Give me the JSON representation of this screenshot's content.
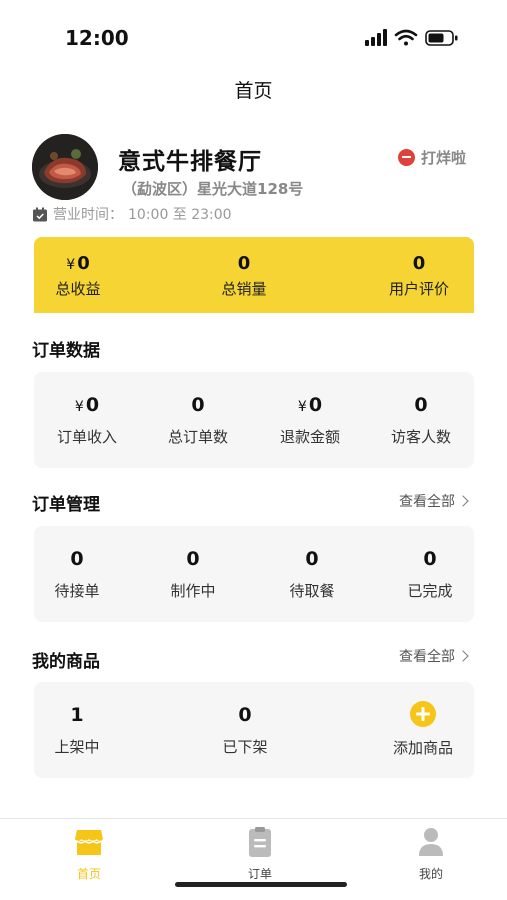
{
  "status_bar": {
    "time": "12:00"
  },
  "nav": {
    "title": "首页"
  },
  "store": {
    "name": "意式牛排餐厅",
    "address": "（勐波区）星光大道128号",
    "close_label": "打烊啦",
    "hours_label": "营业时间：",
    "hours_value": "10:00 至 23:00"
  },
  "summary": {
    "currency": "¥",
    "items": [
      {
        "value": "0",
        "label": "总收益"
      },
      {
        "value": "0",
        "label": "总销量"
      },
      {
        "value": "0",
        "label": "用户评价"
      }
    ]
  },
  "order_data": {
    "title": "订单数据",
    "items": [
      {
        "value": "0",
        "label": "订单收入"
      },
      {
        "value": "0",
        "label": "总订单数"
      },
      {
        "value": "0",
        "label": "退款金额"
      },
      {
        "value": "0",
        "label": "访客人数"
      }
    ]
  },
  "order_management": {
    "title": "订单管理",
    "view_all": "查看全部",
    "items": [
      {
        "value": "0",
        "label": "待接单"
      },
      {
        "value": "0",
        "label": "制作中"
      },
      {
        "value": "0",
        "label": "待取餐"
      },
      {
        "value": "0",
        "label": "已完成"
      }
    ]
  },
  "products": {
    "title": "我的商品",
    "view_all": "查看全部",
    "on_shelf": {
      "value": "1",
      "label": "上架中"
    },
    "off_shelf": {
      "value": "0",
      "label": "已下架"
    },
    "add_label": "添加商品"
  },
  "tab_bar": {
    "active_color": "#f5c518",
    "inactive_color": "#bbbbbb",
    "tabs": [
      {
        "label": "首页",
        "icon": "store-icon"
      },
      {
        "label": "订单",
        "icon": "clipboard-icon"
      },
      {
        "label": "我的",
        "icon": "user-icon"
      }
    ]
  },
  "colors": {
    "accent": "#f5d433",
    "close_red": "#e0413a"
  }
}
